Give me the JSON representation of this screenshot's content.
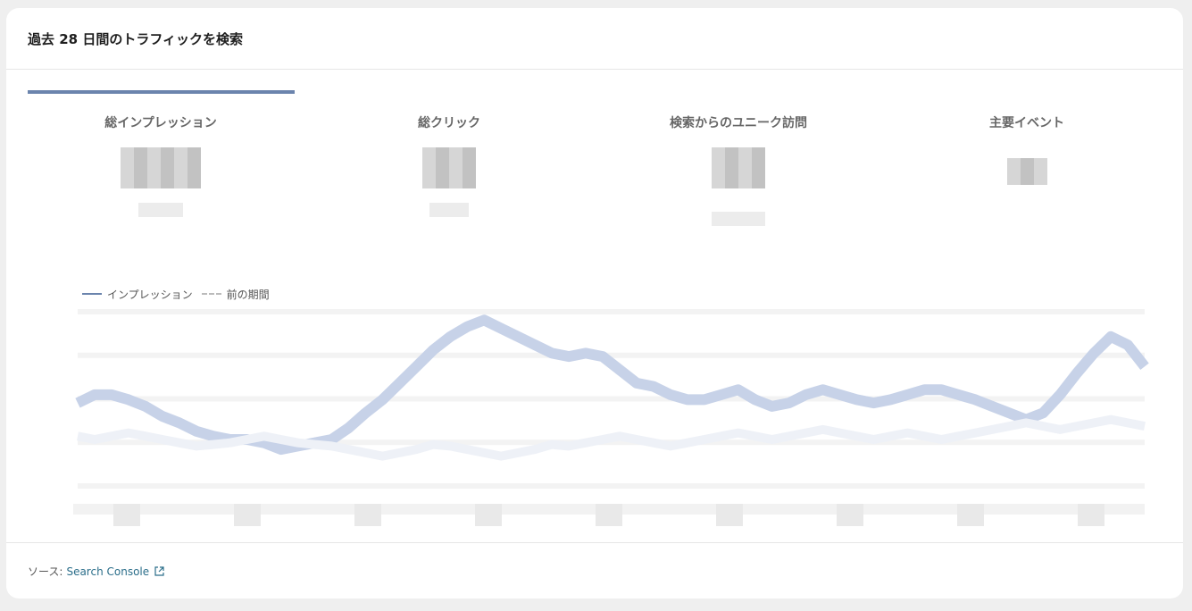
{
  "card": {
    "title": "過去 28 日間のトラフィックを検索"
  },
  "metrics": [
    {
      "label": "総インプレッション",
      "active": true
    },
    {
      "label": "総クリック",
      "active": false
    },
    {
      "label": "検索からのユニーク訪問",
      "active": false
    },
    {
      "label": "主要イベント",
      "active": false
    }
  ],
  "legend": {
    "current": "インプレッション",
    "previous": "前の期間"
  },
  "colors": {
    "accent": "#6b84ad",
    "series_line": "#c7d2e8",
    "link": "#2b6e8a"
  },
  "chart_data": {
    "type": "line",
    "series": [
      {
        "name": "インプレッション",
        "values": [
          50,
          55,
          55,
          52,
          48,
          42,
          38,
          33,
          30,
          28,
          28,
          26,
          22,
          24,
          26,
          28,
          35,
          44,
          52,
          62,
          72,
          82,
          90,
          96,
          100,
          95,
          90,
          85,
          80,
          78,
          80,
          78,
          70,
          62,
          60,
          55,
          52,
          52,
          55,
          58,
          52,
          48,
          50,
          55,
          58,
          55,
          52,
          50,
          52,
          55,
          58,
          58,
          55,
          52,
          48,
          44,
          40,
          44,
          55,
          68,
          80,
          90,
          85,
          72
        ]
      },
      {
        "name": "前の期間",
        "values": [
          30,
          28,
          30,
          32,
          30,
          28,
          26,
          24,
          25,
          26,
          28,
          30,
          28,
          26,
          25,
          24,
          22,
          20,
          18,
          20,
          22,
          25,
          24,
          22,
          20,
          18,
          20,
          22,
          25,
          24,
          26,
          28,
          30,
          28,
          26,
          24,
          26,
          28,
          30,
          32,
          30,
          28,
          30,
          32,
          34,
          32,
          30,
          28,
          30,
          32,
          30,
          28,
          30,
          32,
          34,
          36,
          38,
          36,
          34,
          36,
          38,
          40,
          38,
          36
        ]
      }
    ]
  },
  "footer": {
    "source_label": "ソース:",
    "source_link": "Search Console"
  }
}
